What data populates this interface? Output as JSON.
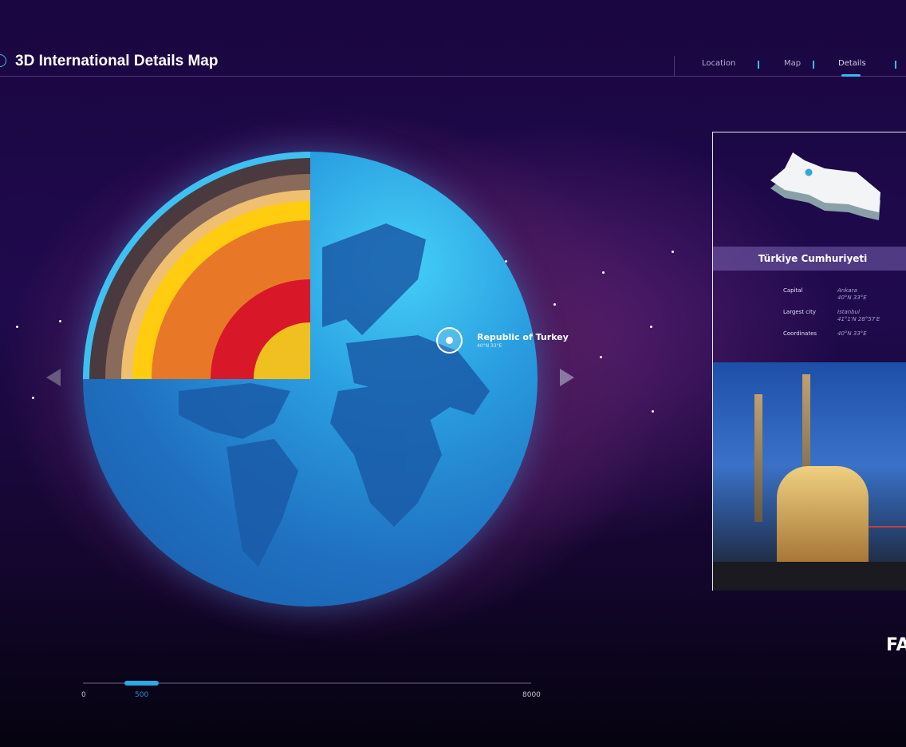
{
  "header": {
    "title": "3D International Details Map",
    "nav": [
      "Location",
      "Map",
      "Details"
    ],
    "active": "Details"
  },
  "marker": {
    "label": "Republic of Turkey",
    "coords": "40°N 33°E"
  },
  "panel": {
    "name": "Türkiye Cumhuriyeti",
    "rows": [
      {
        "label": "Capital",
        "value": "Ankara",
        "sub": "40°N 33°E"
      },
      {
        "label": "Largest city",
        "value": "Istanbul",
        "sub": "41°1′N 28°57′E"
      },
      {
        "label": "Coordinates",
        "value": "40°N 33°E",
        "sub": ""
      }
    ]
  },
  "slider": {
    "min": "0",
    "value": "500",
    "max": "8000"
  },
  "partial_text": "FA",
  "colors": {
    "accent": "#3fb8f0",
    "globe": "#2a8ed8"
  }
}
